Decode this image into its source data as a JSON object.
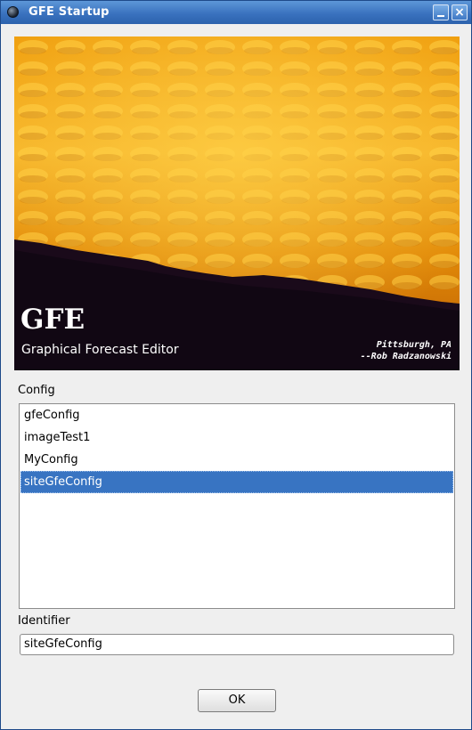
{
  "window": {
    "title": "GFE Startup"
  },
  "banner": {
    "title": "GFE",
    "subtitle": "Graphical Forecast Editor",
    "credit_line1": "Pittsburgh, PA",
    "credit_line2": "--Rob Radzanowski"
  },
  "config": {
    "label": "Config",
    "items": [
      "gfeConfig",
      "imageTest1",
      "MyConfig",
      "siteGfeConfig"
    ],
    "selected": "siteGfeConfig"
  },
  "identifier": {
    "label": "Identifier",
    "value": "siteGfeConfig"
  },
  "ok_label": "OK",
  "icons": {
    "app": "app-icon",
    "minimize": "minimize-icon",
    "close": "close-icon"
  }
}
